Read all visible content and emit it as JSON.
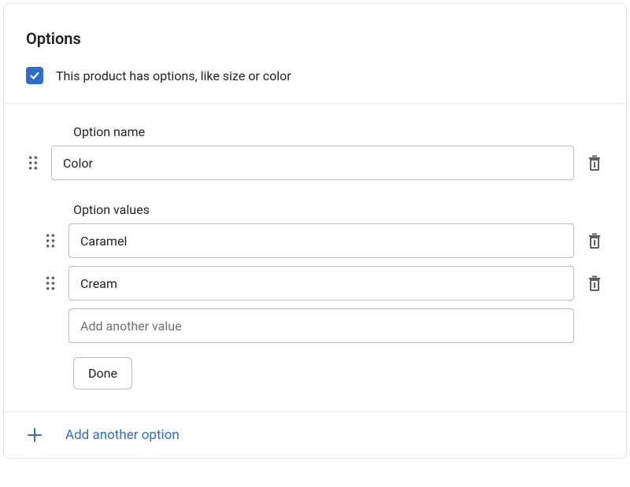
{
  "header": {
    "title": "Options",
    "checkbox_label": "This product has options, like size or color",
    "checked": true
  },
  "option": {
    "name_label": "Option name",
    "name_value": "Color",
    "values_label": "Option values",
    "values": [
      {
        "value": "Caramel"
      },
      {
        "value": "Cream"
      }
    ],
    "add_value_placeholder": "Add another value",
    "done_label": "Done"
  },
  "footer": {
    "add_option_label": "Add another option"
  }
}
